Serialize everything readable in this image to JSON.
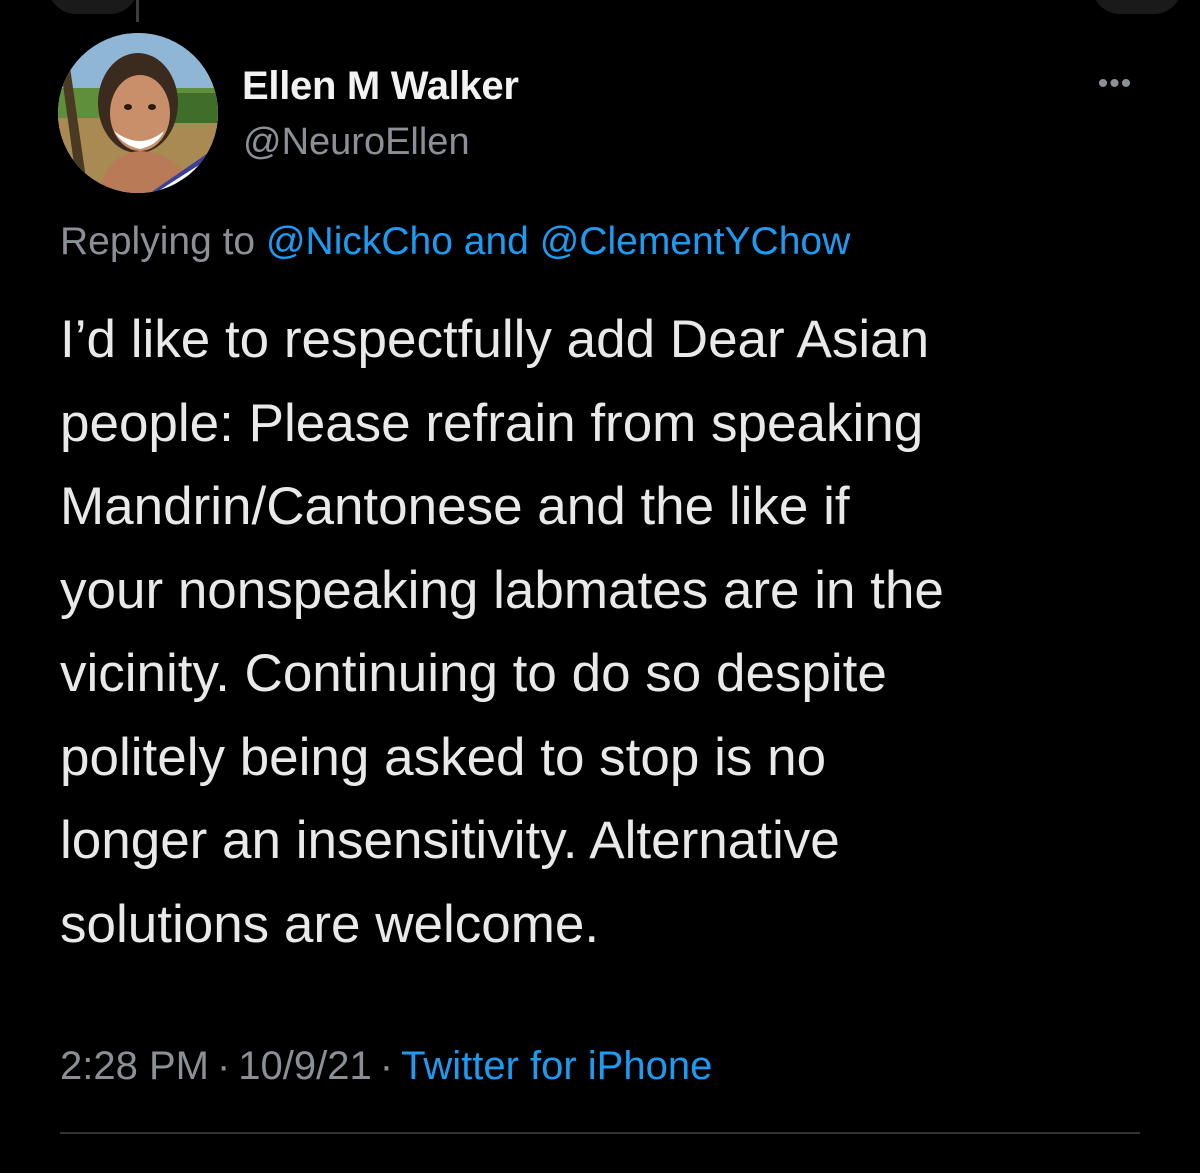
{
  "tweet": {
    "author": {
      "display_name": "Ellen M Walker",
      "handle": "@NeuroEllen"
    },
    "more_icon": "ellipsis-icon",
    "replying": {
      "prefix": "Replying to",
      "mention_1": "@NickCho",
      "conjunction": "and",
      "mention_2": "@ClementYChow"
    },
    "body_lines": [
      "I’d like to respectfully add Dear Asian",
      "people: Please refrain from speaking",
      "Mandrin/Cantonese and the like if",
      "your nonspeaking labmates are in the",
      "vicinity. Continuing to do so despite",
      "politely being asked to stop is no",
      "longer an insensitivity. Alternative",
      "solutions are welcome."
    ],
    "meta": {
      "time": "2:28 PM",
      "date": "10/9/21",
      "separator": "·",
      "source": "Twitter for iPhone"
    }
  },
  "colors": {
    "background": "#000000",
    "primary_text": "#e7e9ea",
    "secondary_text": "#8b9096",
    "link": "#1d9bf0",
    "divider": "#2f3336"
  }
}
